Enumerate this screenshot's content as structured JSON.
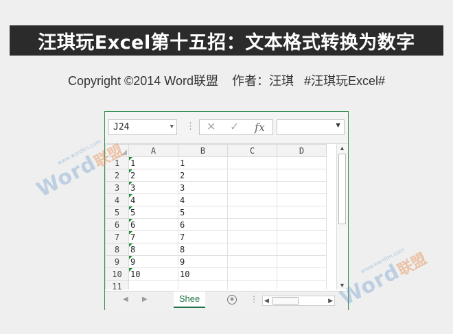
{
  "header": {
    "title": "汪琪玩Excel第十五招：文本格式转换为数字",
    "subtitle": "Copyright ©2014 Word联盟    作者：汪琪   #汪琪玩Excel#"
  },
  "excel": {
    "name_box": "J24",
    "formula_buttons": {
      "cancel": "✕",
      "enter": "✓",
      "fx": "fx"
    },
    "formula_value": "",
    "columns": [
      "A",
      "B",
      "C",
      "D"
    ],
    "rows": [
      {
        "num": "1",
        "a": "1",
        "b": "1"
      },
      {
        "num": "2",
        "a": "2",
        "b": "2"
      },
      {
        "num": "3",
        "a": "3",
        "b": "3"
      },
      {
        "num": "4",
        "a": "4",
        "b": "4"
      },
      {
        "num": "5",
        "a": "5",
        "b": "5"
      },
      {
        "num": "6",
        "a": "6",
        "b": "6"
      },
      {
        "num": "7",
        "a": "7",
        "b": "7"
      },
      {
        "num": "8",
        "a": "8",
        "b": "8"
      },
      {
        "num": "9",
        "a": "9",
        "b": "9"
      },
      {
        "num": "10",
        "a": "10",
        "b": "10"
      },
      {
        "num": "11",
        "a": "",
        "b": ""
      }
    ],
    "sheet_tab": "Shee",
    "text_number_indicator_color": "#1f8a3a"
  },
  "watermark": {
    "brand": "Word",
    "cn": "联盟",
    "url": "www.wordlm.com"
  },
  "colors": {
    "excel_green": "#217346",
    "title_bg": "#2b2b2b"
  }
}
